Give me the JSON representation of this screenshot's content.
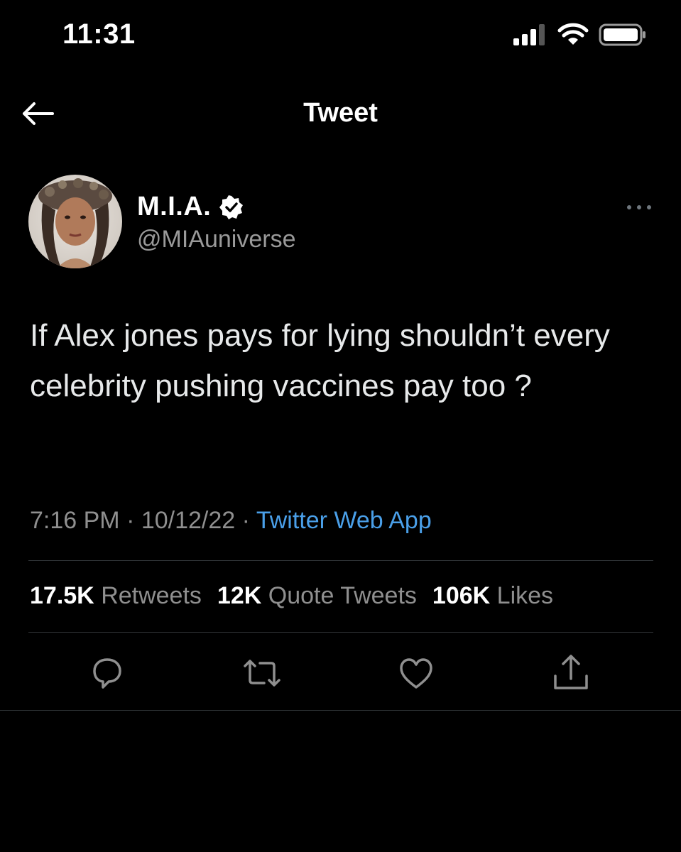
{
  "status_bar": {
    "time": "11:31"
  },
  "nav": {
    "title": "Tweet"
  },
  "tweet": {
    "author": {
      "display_name": "M.I.A.",
      "handle": "@MIAuniverse",
      "verified": true
    },
    "text": "If Alex jones pays for lying shouldn’t every celebrity pushing vaccines pay too ?",
    "time": "7:16 PM",
    "date": "10/12/22",
    "separator": " · ",
    "source": "Twitter Web App",
    "stats": [
      {
        "count": "17.5K",
        "label": "Retweets"
      },
      {
        "count": "12K",
        "label": "Quote Tweets"
      },
      {
        "count": "106K",
        "label": "Likes"
      }
    ]
  },
  "icons": {
    "back": "back-arrow-icon",
    "verified": "verified-badge-icon",
    "more": "more-horizontal-icon",
    "reply": "reply-icon",
    "retweet": "retweet-icon",
    "like": "heart-icon",
    "share": "share-icon"
  },
  "colors": {
    "background": "#000000",
    "text": "#e7e9ea",
    "secondary_text": "#8f8f8f",
    "link": "#4a9fe8",
    "divider": "#2f3336"
  }
}
